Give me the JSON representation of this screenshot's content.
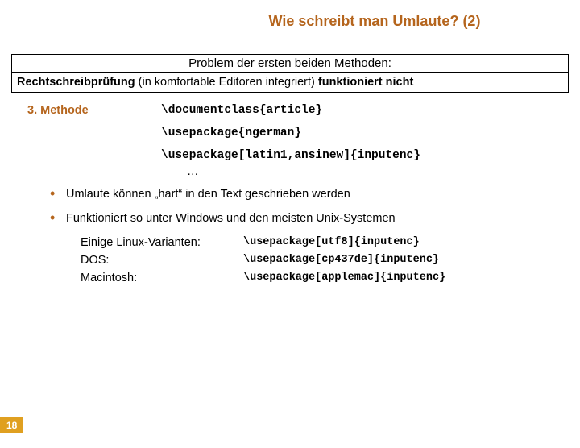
{
  "title": "Wie schreibt man Umlaute? (2)",
  "box": {
    "heading": "Problem der ersten beiden Methoden:",
    "body_bold1": "Rechtschreibprüfung",
    "body_plain": " (in komfortable Editoren integriert) ",
    "body_bold2": "funktioniert nicht"
  },
  "method_label": "3. Methode",
  "code": {
    "l1": "\\documentclass{article}",
    "l2": "\\usepackage{ngerman}",
    "l3": "\\usepackage[latin1,ansinew]{inputenc}",
    "ellipsis": "…"
  },
  "bullets": {
    "b1": "Umlaute können „hart“ in den Text geschrieben werden",
    "b2": "Funktioniert so unter Windows und den meisten Unix-Systemen"
  },
  "os": {
    "linux_label": "Einige Linux-Varianten:",
    "linux_code": "\\usepackage[utf8]{inputenc}",
    "dos_label": "DOS:",
    "dos_code": "\\usepackage[cp437de]{inputenc}",
    "mac_label": "Macintosh:",
    "mac_code": "\\usepackage[applemac]{inputenc}"
  },
  "page": "18"
}
